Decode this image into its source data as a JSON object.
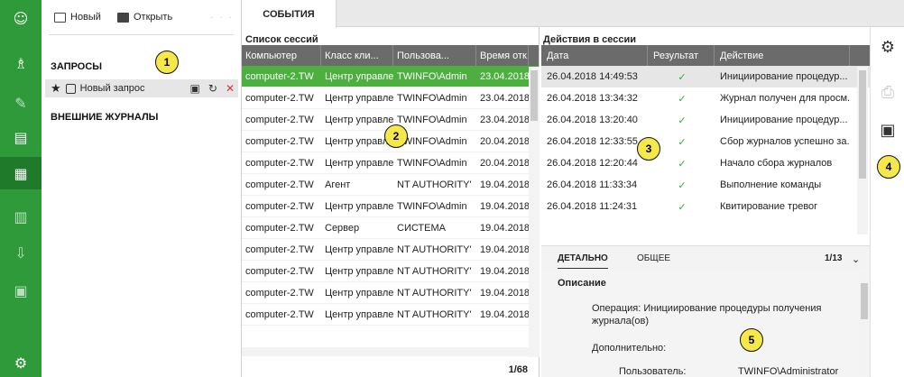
{
  "rail": {
    "icons": [
      "user-icon",
      "user-group-icon",
      "puzzle-icon",
      "journal-icon",
      "requests-icon",
      "calendar-icon",
      "download-icon",
      "report-icon",
      "settings-icon"
    ]
  },
  "toolbar": {
    "new_label": "Новый",
    "open_label": "Открыть"
  },
  "left": {
    "requests_title": "ЗАПРОСЫ",
    "new_request_label": "Новый запрос",
    "external_title": "ВНЕШНИЕ ЖУРНАЛЫ"
  },
  "tabs": {
    "events": "СОБЫТИЯ"
  },
  "sessions": {
    "title": "Список сессий",
    "columns": [
      "Компьютер",
      "Класс кли...",
      "Пользова...",
      "Время отк..."
    ],
    "rows": [
      [
        "computer-2.TW",
        "Центр управле",
        "TWINFO\\Admin",
        "23.04.2018"
      ],
      [
        "computer-2.TW",
        "Центр управле",
        "TWINFO\\Admin",
        "23.04.2018"
      ],
      [
        "computer-2.TW",
        "Центр управле",
        "TWINFO\\Admin",
        "23.04.2018"
      ],
      [
        "computer-2.TW",
        "Центр управле",
        "TWINFO\\Admin",
        "20.04.2018"
      ],
      [
        "computer-2.TW",
        "Центр управле",
        "TWINFO\\Admin",
        "20.04.2018"
      ],
      [
        "computer-2.TW",
        "Агент",
        "NT AUTHORITY'",
        "19.04.2018"
      ],
      [
        "computer-2.TW",
        "Центр управле",
        "TWINFO\\Admin",
        "19.04.2018"
      ],
      [
        "computer-2.TW",
        "Сервер",
        "СИСТЕМА",
        "19.04.2018"
      ],
      [
        "computer-2.TW",
        "Центр управле",
        "NT AUTHORITY'",
        "19.04.2018"
      ],
      [
        "computer-2.TW",
        "Центр управле",
        "NT AUTHORITY'",
        "19.04.2018"
      ],
      [
        "computer-2.TW",
        "Центр управле",
        "NT AUTHORITY'",
        "19.04.2018"
      ],
      [
        "computer-2.TW",
        "Центр управле",
        "NT AUTHORITY'",
        "19.04.2018"
      ]
    ],
    "count": "1/68"
  },
  "actions": {
    "title": "Действия в сессии",
    "columns": [
      "Дата",
      "Результат",
      "Действие"
    ],
    "rows": [
      [
        "26.04.2018 14:49:53",
        "✓",
        "Инициирование процедур..."
      ],
      [
        "26.04.2018 13:34:32",
        "✓",
        "Журнал получен для просм..."
      ],
      [
        "26.04.2018 13:20:40",
        "✓",
        "Инициирование процедур..."
      ],
      [
        "26.04.2018 12:33:55",
        "✓",
        "Сбор журналов успешно за..."
      ],
      [
        "26.04.2018 12:20:44",
        "✓",
        "Начало сбора журналов"
      ],
      [
        "26.04.2018 11:33:34",
        "✓",
        "Выполнение команды"
      ],
      [
        "26.04.2018 11:24:31",
        "✓",
        "Квитирование тревог"
      ]
    ]
  },
  "details": {
    "tab_detail": "ДЕТАЛЬНО",
    "tab_general": "ОБЩЕЕ",
    "count": "1/13",
    "heading": "Описание",
    "operation_line1": "Операция:  Инициирование процедуры получения",
    "operation_line2": "журнала(ов)",
    "additional": "Дополнительно:",
    "user_label": "Пользователь:",
    "user_value": "TWINFO\\Administrator"
  },
  "callouts": [
    "1",
    "2",
    "3",
    "4",
    "5"
  ]
}
